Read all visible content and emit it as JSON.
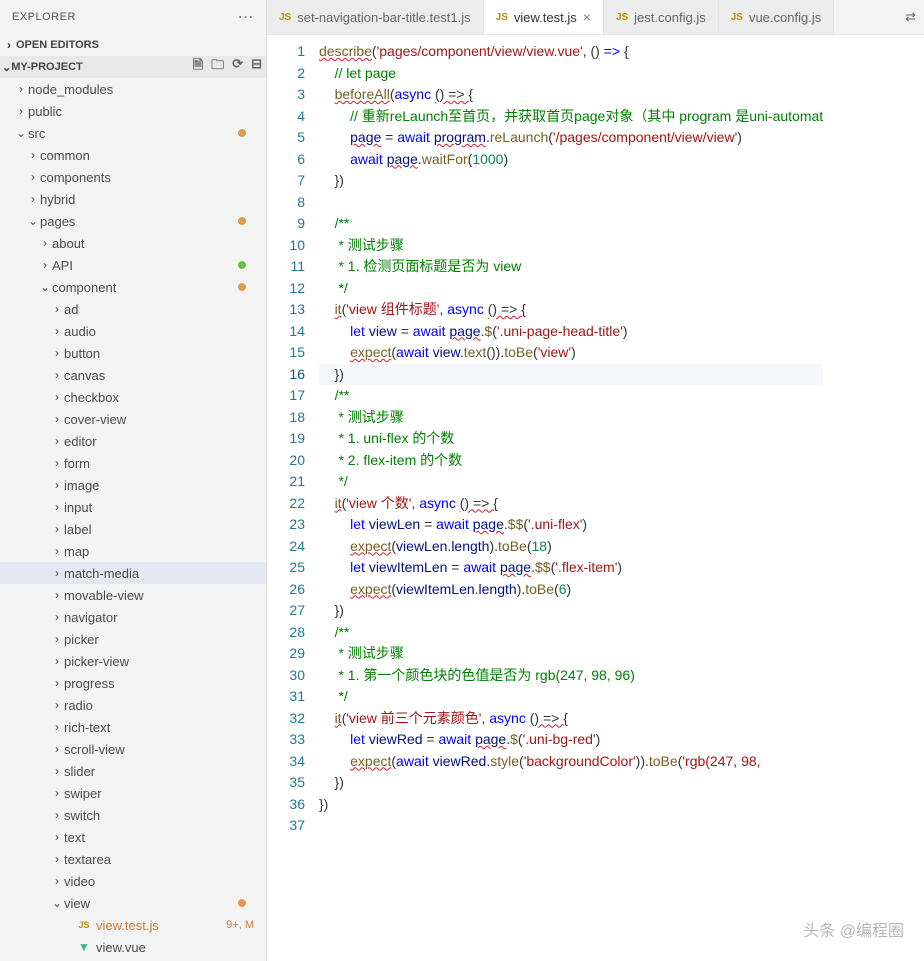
{
  "explorer": {
    "title": "EXPLORER",
    "open_editors": "OPEN EDITORS",
    "project": "MY-PROJECT"
  },
  "tree": [
    {
      "label": "node_modules",
      "depth": 0,
      "chev": "›",
      "type": "folder"
    },
    {
      "label": "public",
      "depth": 0,
      "chev": "›",
      "type": "folder"
    },
    {
      "label": "src",
      "depth": 0,
      "chev": "⌄",
      "type": "folder",
      "dot": "orange"
    },
    {
      "label": "common",
      "depth": 1,
      "chev": "›",
      "type": "folder"
    },
    {
      "label": "components",
      "depth": 1,
      "chev": "›",
      "type": "folder"
    },
    {
      "label": "hybrid",
      "depth": 1,
      "chev": "›",
      "type": "folder"
    },
    {
      "label": "pages",
      "depth": 1,
      "chev": "⌄",
      "type": "folder",
      "dot": "orange"
    },
    {
      "label": "about",
      "depth": 2,
      "chev": "›",
      "type": "folder"
    },
    {
      "label": "API",
      "depth": 2,
      "chev": "›",
      "type": "folder",
      "dot": "green"
    },
    {
      "label": "component",
      "depth": 2,
      "chev": "⌄",
      "type": "folder",
      "dot": "orange"
    },
    {
      "label": "ad",
      "depth": 3,
      "chev": "›",
      "type": "folder"
    },
    {
      "label": "audio",
      "depth": 3,
      "chev": "›",
      "type": "folder"
    },
    {
      "label": "button",
      "depth": 3,
      "chev": "›",
      "type": "folder"
    },
    {
      "label": "canvas",
      "depth": 3,
      "chev": "›",
      "type": "folder"
    },
    {
      "label": "checkbox",
      "depth": 3,
      "chev": "›",
      "type": "folder"
    },
    {
      "label": "cover-view",
      "depth": 3,
      "chev": "›",
      "type": "folder"
    },
    {
      "label": "editor",
      "depth": 3,
      "chev": "›",
      "type": "folder"
    },
    {
      "label": "form",
      "depth": 3,
      "chev": "›",
      "type": "folder"
    },
    {
      "label": "image",
      "depth": 3,
      "chev": "›",
      "type": "folder"
    },
    {
      "label": "input",
      "depth": 3,
      "chev": "›",
      "type": "folder"
    },
    {
      "label": "label",
      "depth": 3,
      "chev": "›",
      "type": "folder"
    },
    {
      "label": "map",
      "depth": 3,
      "chev": "›",
      "type": "folder"
    },
    {
      "label": "match-media",
      "depth": 3,
      "chev": "›",
      "type": "folder",
      "selected": true
    },
    {
      "label": "movable-view",
      "depth": 3,
      "chev": "›",
      "type": "folder"
    },
    {
      "label": "navigator",
      "depth": 3,
      "chev": "›",
      "type": "folder"
    },
    {
      "label": "picker",
      "depth": 3,
      "chev": "›",
      "type": "folder"
    },
    {
      "label": "picker-view",
      "depth": 3,
      "chev": "›",
      "type": "folder"
    },
    {
      "label": "progress",
      "depth": 3,
      "chev": "›",
      "type": "folder"
    },
    {
      "label": "radio",
      "depth": 3,
      "chev": "›",
      "type": "folder"
    },
    {
      "label": "rich-text",
      "depth": 3,
      "chev": "›",
      "type": "folder"
    },
    {
      "label": "scroll-view",
      "depth": 3,
      "chev": "›",
      "type": "folder"
    },
    {
      "label": "slider",
      "depth": 3,
      "chev": "›",
      "type": "folder"
    },
    {
      "label": "swiper",
      "depth": 3,
      "chev": "›",
      "type": "folder"
    },
    {
      "label": "switch",
      "depth": 3,
      "chev": "›",
      "type": "folder"
    },
    {
      "label": "text",
      "depth": 3,
      "chev": "›",
      "type": "folder"
    },
    {
      "label": "textarea",
      "depth": 3,
      "chev": "›",
      "type": "folder"
    },
    {
      "label": "video",
      "depth": 3,
      "chev": "›",
      "type": "folder"
    },
    {
      "label": "view",
      "depth": 3,
      "chev": "⌄",
      "type": "folder",
      "dot": "orange"
    },
    {
      "label": "view.test.js",
      "depth": 4,
      "chev": "",
      "type": "file-js",
      "status": "9+, M",
      "file_color": "#c97e3f"
    },
    {
      "label": "view.vue",
      "depth": 4,
      "chev": "",
      "type": "file-vue"
    }
  ],
  "tabs": [
    {
      "label": "set-navigation-bar-title.test1.js",
      "icon": "JS",
      "active": false
    },
    {
      "label": "view.test.js",
      "icon": "JS",
      "active": true
    },
    {
      "label": "jest.config.js",
      "icon": "JS",
      "active": false
    },
    {
      "label": "vue.config.js",
      "icon": "JS",
      "active": false
    }
  ],
  "code": {
    "lines": [
      {
        "n": 1,
        "html": "<span class='fn squig'>describe</span>(<span class='str'>'pages/component/view/view.vue'</span>, () <span class='kw'>=&gt;</span> {"
      },
      {
        "n": 2,
        "html": "    <span class='cmt'>// let page</span>"
      },
      {
        "n": 3,
        "html": "    <span class='fn squig'>beforeAll</span>(<span class='kw'>async</span> <span class='squig'>() =&gt; {</span>"
      },
      {
        "n": 4,
        "html": "        <span class='cmt'>// 重新reLaunch至首页，并获取首页page对象（其中 program 是uni-automat</span>"
      },
      {
        "n": 5,
        "html": "        <span class='id squig'>page</span> = <span class='kw'>await</span> <span class='id squig'>program</span>.<span class='fn'>reLaunch</span>(<span class='str'>'/pages/component/view/view'</span>)"
      },
      {
        "n": 6,
        "html": "        <span class='kw'>await</span> <span class='id squig'>page</span>.<span class='fn'>waitFor</span>(<span class='num'>1000</span>)"
      },
      {
        "n": 7,
        "html": "    })"
      },
      {
        "n": 8,
        "html": ""
      },
      {
        "n": 9,
        "html": "    <span class='cmt'>/**</span>"
      },
      {
        "n": 10,
        "html": "<span class='cmt'>     * 测试步骤</span>"
      },
      {
        "n": 11,
        "html": "<span class='cmt'>     * 1. 检测页面标题是否为 view</span>"
      },
      {
        "n": 12,
        "html": "<span class='cmt'>     */</span>"
      },
      {
        "n": 13,
        "html": "    <span class='fn squig'>it</span>(<span class='str'>'view 组件标题'</span>, <span class='kw'>async</span> <span class='squig'>() =&gt; {</span>"
      },
      {
        "n": 14,
        "html": "        <span class='kw'>let</span> <span class='id'>view</span> = <span class='kw'>await</span> <span class='id squig'>page</span>.<span class='fn'>$</span>(<span class='str'>'.uni-page-head-title'</span>)"
      },
      {
        "n": 15,
        "html": "        <span class='fn squig'>expect</span>(<span class='kw'>await</span> <span class='id'>view</span>.<span class='fn'>text</span>()).<span class='fn'>toBe</span>(<span class='str'>'view'</span>)"
      },
      {
        "n": 16,
        "html": "    })",
        "current": true
      },
      {
        "n": 17,
        "html": "    <span class='cmt'>/**</span>"
      },
      {
        "n": 18,
        "html": "<span class='cmt'>     * 测试步骤</span>"
      },
      {
        "n": 19,
        "html": "<span class='cmt'>     * 1. uni-flex 的个数</span>"
      },
      {
        "n": 20,
        "html": "<span class='cmt'>     * 2. flex-item 的个数</span>"
      },
      {
        "n": 21,
        "html": "<span class='cmt'>     */</span>"
      },
      {
        "n": 22,
        "html": "    <span class='fn squig'>it</span>(<span class='str'>'view 个数'</span>, <span class='kw'>async</span> <span class='squig'>() =&gt; {</span>"
      },
      {
        "n": 23,
        "html": "        <span class='kw'>let</span> <span class='id'>viewLen</span> = <span class='kw'>await</span> <span class='id squig'>page</span>.<span class='fn'>$$</span>(<span class='str'>'.uni-flex'</span>)"
      },
      {
        "n": 24,
        "html": "        <span class='fn squig'>expect</span>(<span class='id'>viewLen</span>.<span class='id'>length</span>).<span class='fn'>toBe</span>(<span class='num'>18</span>)"
      },
      {
        "n": 25,
        "html": "        <span class='kw'>let</span> <span class='id'>viewItemLen</span> = <span class='kw'>await</span> <span class='id squig'>page</span>.<span class='fn'>$$</span>(<span class='str'>'.flex-item'</span>)"
      },
      {
        "n": 26,
        "html": "        <span class='fn squig'>expect</span>(<span class='id'>viewItemLen</span>.<span class='id'>length</span>).<span class='fn'>toBe</span>(<span class='num'>6</span>)"
      },
      {
        "n": 27,
        "html": "    })"
      },
      {
        "n": 28,
        "html": "    <span class='cmt'>/**</span>"
      },
      {
        "n": 29,
        "html": "<span class='cmt'>     * 测试步骤</span>"
      },
      {
        "n": 30,
        "html": "<span class='cmt'>     * 1. 第一个颜色块的色值是否为 rgb(247, 98, 96)</span>"
      },
      {
        "n": 31,
        "html": "<span class='cmt'>     */</span>"
      },
      {
        "n": 32,
        "html": "    <span class='fn squig'>it</span>(<span class='str'>'view 前三个元素颜色'</span>, <span class='kw'>async</span> <span class='squig'>() =&gt; {</span>"
      },
      {
        "n": 33,
        "html": "        <span class='kw'>let</span> <span class='id'>viewRed</span> = <span class='kw'>await</span> <span class='id squig'>page</span>.<span class='fn'>$</span>(<span class='str'>'.uni-bg-red'</span>)"
      },
      {
        "n": 34,
        "html": "        <span class='fn squig'>expect</span>(<span class='kw'>await</span> <span class='id'>viewRed</span>.<span class='fn'>style</span>(<span class='str'>'backgroundColor'</span>)).<span class='fn'>toBe</span>(<span class='str'>'rgb(247, 98,</span>"
      },
      {
        "n": 35,
        "html": "    })"
      },
      {
        "n": 36,
        "html": "})"
      },
      {
        "n": 37,
        "html": ""
      }
    ]
  },
  "watermark": "头条 @编程圈"
}
